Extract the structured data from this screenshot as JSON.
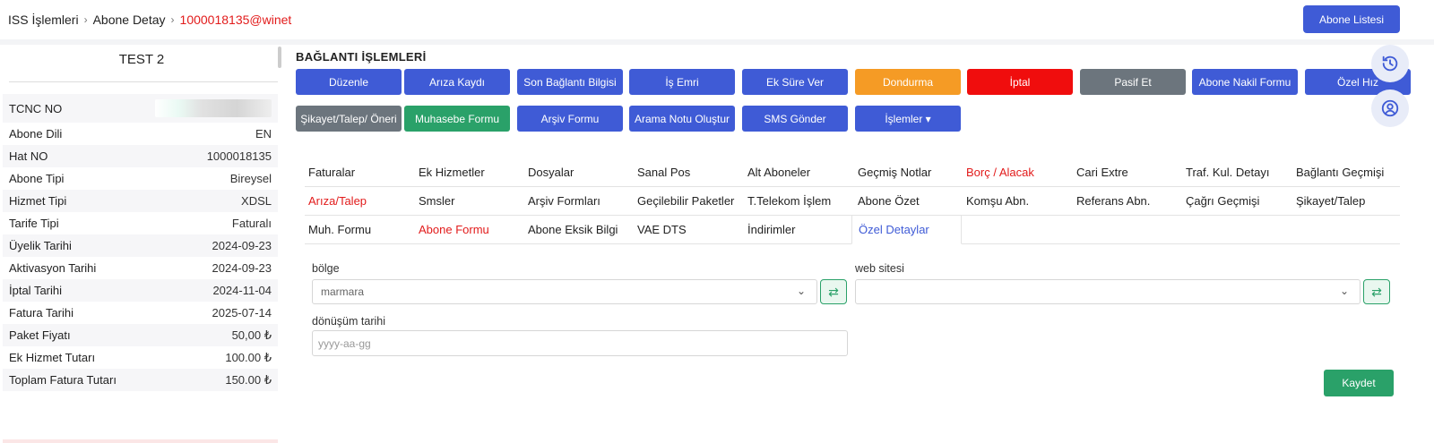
{
  "breadcrumb": {
    "items": [
      "ISS İşlemleri",
      "Abone Detay",
      "1000018135@winet"
    ],
    "separator": "›"
  },
  "header": {
    "list_button": "Abone Listesi"
  },
  "subscriber": {
    "name": "TEST 2",
    "fields": [
      {
        "label": "TCNC NO",
        "value": ""
      },
      {
        "label": "Abone Dili",
        "value": "EN"
      },
      {
        "label": "Hat NO",
        "value": "1000018135"
      },
      {
        "label": "Abone Tipi",
        "value": "Bireysel"
      },
      {
        "label": "Hizmet Tipi",
        "value": "XDSL"
      },
      {
        "label": "Tarife Tipi",
        "value": "Faturalı"
      },
      {
        "label": "Üyelik Tarihi",
        "value": "2024-09-23"
      },
      {
        "label": "Aktivasyon Tarihi",
        "value": "2024-09-23"
      },
      {
        "label": "İptal Tarihi",
        "value": "2024-11-04"
      },
      {
        "label": "Fatura Tarihi",
        "value": "2025-07-14"
      },
      {
        "label": "Paket Fiyatı",
        "value": "50,00 ₺"
      },
      {
        "label": "Ek Hizmet Tutarı",
        "value": "100.00 ₺"
      },
      {
        "label": "Toplam Fatura Tutarı",
        "value": "150.00 ₺"
      }
    ]
  },
  "section": {
    "title": "BAĞLANTI İŞLEMLERİ"
  },
  "actions": {
    "row1": [
      "Düzenle",
      "Arıza Kaydı",
      "Son Bağlantı Bilgisi",
      "İş Emri",
      "Ek Süre Ver",
      "Dondurma",
      "İptal",
      "Pasif Et",
      "Abone Nakil Formu",
      "Özel Hız"
    ],
    "row2": [
      "Şikayet/Talep/ Öneri",
      "Muhasebe Formu",
      "Arşiv Formu",
      "Arama Notu Oluştur",
      "SMS Gönder",
      "İşlemler ▾"
    ]
  },
  "tabs": {
    "row1": [
      "Faturalar",
      "Ek Hizmetler",
      "Dosyalar",
      "Sanal Pos",
      "Alt Aboneler",
      "Geçmiş Notlar",
      "Borç / Alacak",
      "Cari Extre",
      "Traf. Kul. Detayı",
      "Bağlantı Geçmişi"
    ],
    "row2": [
      "Arıza/Talep",
      "Smsler",
      "Arşiv Formları",
      "Geçilebilir Paketler",
      "T.Telekom İşlem",
      "Abone Özet",
      "Komşu Abn.",
      "Referans Abn.",
      "Çağrı Geçmişi",
      "Şikayet/Talep"
    ],
    "row3": [
      "Muh. Formu",
      "Abone Formu",
      "Abone Eksik Bilgi",
      "VAE DTS",
      "İndirimler",
      "Özel Detaylar"
    ]
  },
  "form": {
    "region_label": "bölge",
    "region_value": "marmara",
    "website_label": "web sitesi",
    "website_value": "",
    "conversion_label": "dönüşüm tarihi",
    "conversion_placeholder": "yyyy-aa-gg",
    "save_label": "Kaydet"
  },
  "colors": {
    "primary": "#3f5bd6",
    "danger": "#f00d0d",
    "warning": "#f59b25",
    "success": "#2aa169",
    "secondary": "#6c757d",
    "link_red": "#e21b1b"
  },
  "icons": {
    "history": "history-icon",
    "user": "user-circle-icon",
    "swap": "swap-icon",
    "chevron": "chevron-down-icon"
  }
}
